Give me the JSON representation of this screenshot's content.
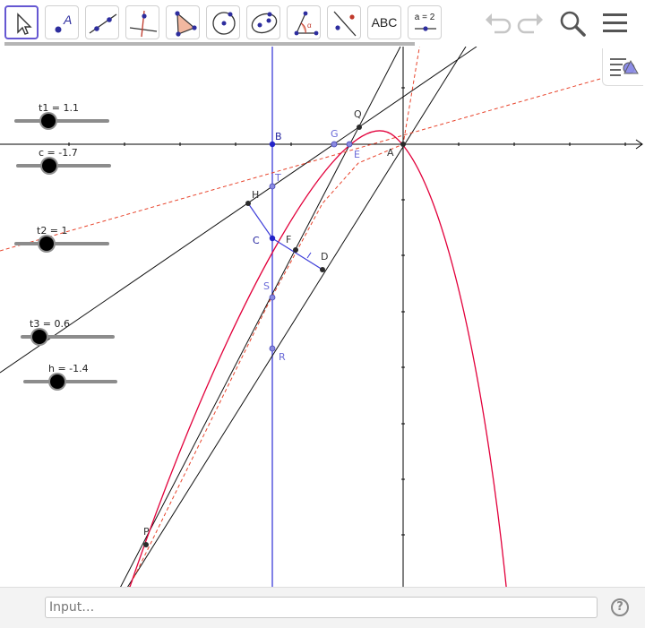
{
  "toolbar": {
    "tools": [
      {
        "name": "move-tool",
        "selected": true
      },
      {
        "name": "point-tool"
      },
      {
        "name": "line-tool"
      },
      {
        "name": "perpendicular-line-tool"
      },
      {
        "name": "polygon-tool"
      },
      {
        "name": "circle-tool"
      },
      {
        "name": "conic-tool"
      },
      {
        "name": "angle-tool"
      },
      {
        "name": "reflect-tool"
      },
      {
        "name": "text-tool",
        "label": "ABC"
      },
      {
        "name": "slider-tool",
        "label": "a = 2"
      }
    ],
    "undo_icon": "undo-icon",
    "redo_icon": "redo-icon",
    "search_icon": "search-icon",
    "menu_icon": "hamburger-menu-icon"
  },
  "sliders": [
    {
      "label": "t1 = 1.1",
      "value": 1.1
    },
    {
      "label": "c = -1.7",
      "value": -1.7
    },
    {
      "label": "t2 = 1",
      "value": 1
    },
    {
      "label": "t3 = 0.6",
      "value": 0.6
    },
    {
      "label": "h = -1.4",
      "value": -1.4
    }
  ],
  "points": {
    "A": "A",
    "B": "B",
    "C": "C",
    "D": "D",
    "E": "E",
    "F": "F",
    "G": "G",
    "H": "H",
    "P": "P",
    "Q": "Q",
    "R": "R",
    "S": "S",
    "T": "T"
  },
  "colors": {
    "accent": "#6557d2",
    "parabola": "#e2003b",
    "dashed": "#e8442c",
    "vertical_line": "#3d3dd9",
    "point_blue": "#6a6ad8",
    "point_dark": "#2a2a2a",
    "axes": "#000000"
  },
  "input_bar": {
    "placeholder": "Input…",
    "value": ""
  },
  "help_icon": "help-icon"
}
